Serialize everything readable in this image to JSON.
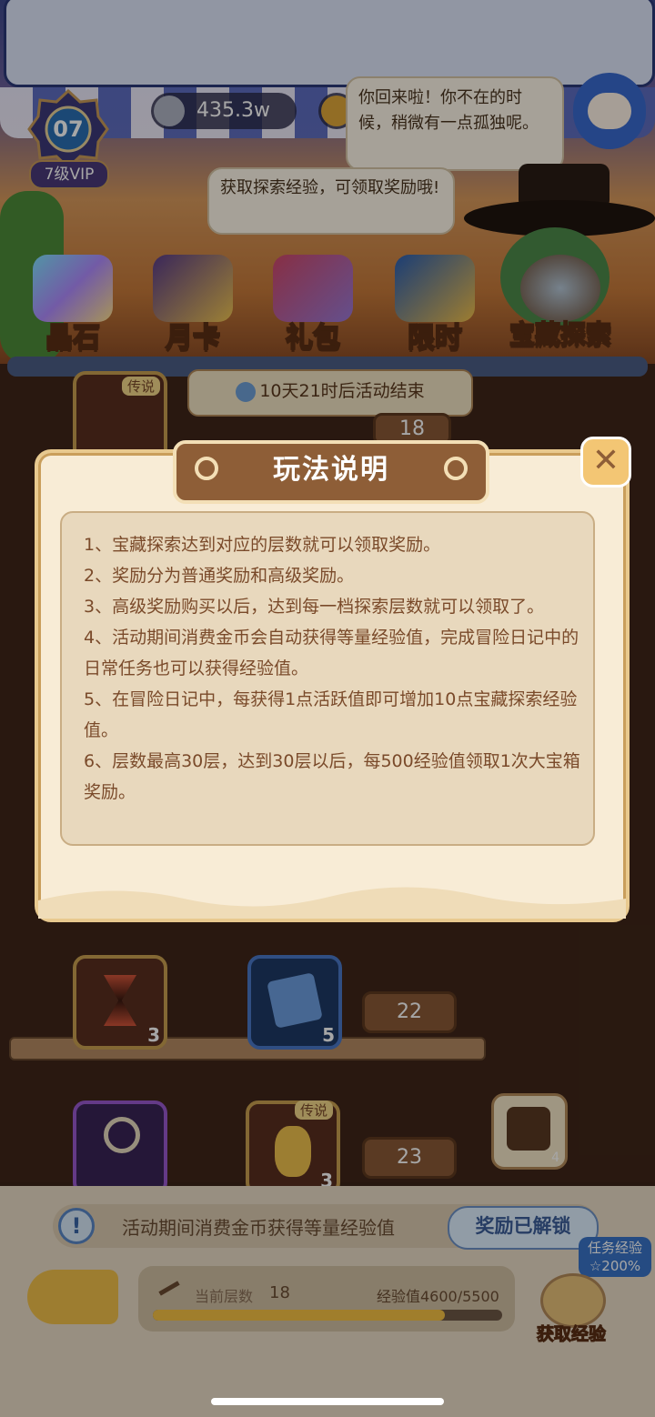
{
  "header": {
    "vip_level": "07",
    "vip_label": "7级VIP",
    "currency_amount": "435.3w",
    "companion_speech": "你回来啦！你不在的时候，稍微有一点孤独呢。",
    "npc_speech": "获取探索经验，可领取奖励哦!"
  },
  "tabs": [
    {
      "label": "晶石",
      "icon": "gem-icon"
    },
    {
      "label": "月卡",
      "icon": "cards-icon"
    },
    {
      "label": "礼包",
      "icon": "gift-icon"
    },
    {
      "label": "限时",
      "icon": "treasure-bag-icon"
    },
    {
      "label": "宝藏探索",
      "icon": "pickaxe-icon"
    }
  ],
  "board": {
    "event_timer": "10天21时后活动结束",
    "legend_tag": "传说",
    "levels": [
      "18",
      "22",
      "23"
    ],
    "item_counts": {
      "hourglass": "3",
      "card": "5",
      "relic": "3",
      "small": "4"
    }
  },
  "modal": {
    "title": "玩法说明",
    "close_label": "✕",
    "rules": [
      "1、宝藏探索达到对应的层数就可以领取奖励。",
      "2、奖励分为普通奖励和高级奖励。",
      "3、高级奖励购买以后，达到每一档探索层数就可以领取了。",
      "4、活动期间消费金币会自动获得等量经验值，完成冒险日记中的日常任务也可以获得经验值。",
      "5、在冒险日记中，每获得1点活跃值即可增加10点宝藏探索经验值。",
      "6、层数最高30层，达到30层以后，每500经验值领取1次大宝箱奖励。"
    ]
  },
  "footer": {
    "notice": "活动期间消费金币获得等量经验值",
    "unlock_label": "奖励已解锁",
    "current_floor_label": "当前层数",
    "current_floor": "18",
    "exp_label": "经验值4600/5500",
    "exp_progress": 0.836,
    "task_exp_label": "任务经验",
    "task_exp_bonus": "☆200%",
    "get_exp_label": "获取经验"
  },
  "colors": {
    "accent": "#8e5e37",
    "text_brown": "#7a4a2a",
    "bar_fill": "#f6c244"
  }
}
